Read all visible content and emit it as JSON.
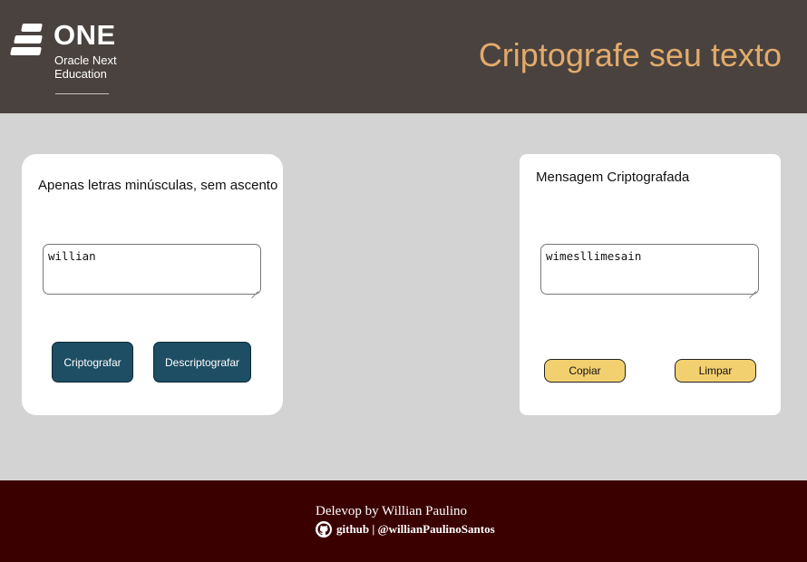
{
  "header": {
    "logo_wordmark": "ONE",
    "logo_subtitle": "Oracle Next Education",
    "title": "Criptografe seu texto",
    "title_color": "#e2ab6b",
    "background": "#4a423f"
  },
  "input_panel": {
    "instruction": "Apenas letras minúsculas, sem ascento",
    "textarea_value": "willian",
    "encrypt_button": "Criptografar",
    "decrypt_button": "Descriptografar",
    "button_color": "#1d4e64"
  },
  "output_panel": {
    "label": "Mensagem Criptografada",
    "textarea_value": "wimesllimesain",
    "copy_button": "Copiar",
    "clear_button": "Limpar",
    "button_color": "#f3d06f"
  },
  "footer": {
    "credit": "Delevop by Willian Paulino",
    "github_icon": "github-icon",
    "github_text": "github | @willianPaulinoSantos",
    "background": "#3a0000"
  }
}
